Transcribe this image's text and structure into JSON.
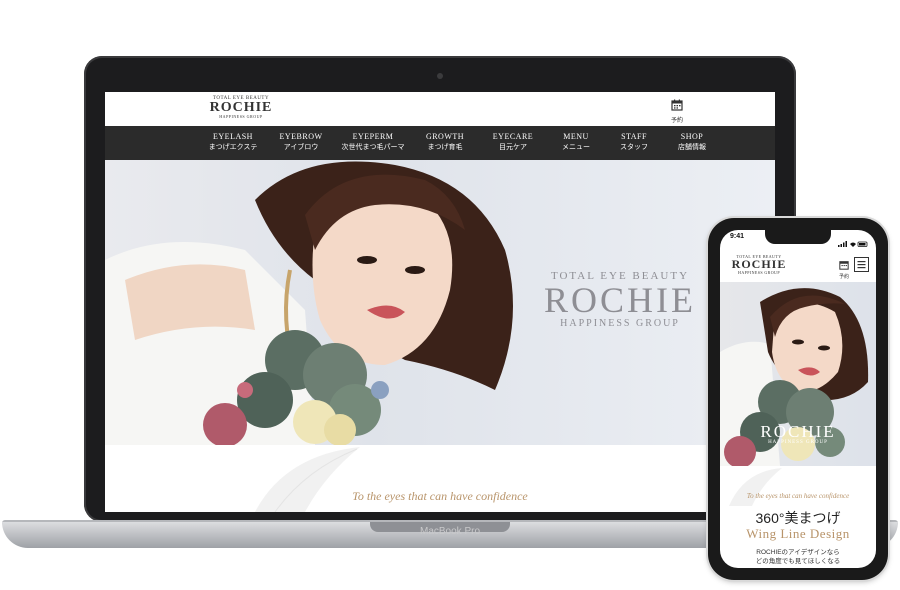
{
  "laptop": {
    "device_label": "MacBook Pro",
    "site": {
      "logo": {
        "tagline": "TOTAL EYE BEAUTY",
        "name": "ROCHIE",
        "sub": "HAPPINESS GROUP"
      },
      "reserve_label": "予約",
      "nav": [
        {
          "en": "EYELASH",
          "jp": "まつげエクステ"
        },
        {
          "en": "EYEBROW",
          "jp": "アイブロウ"
        },
        {
          "en": "EYEPERM",
          "jp": "次世代まつ毛パーマ"
        },
        {
          "en": "GROWTH",
          "jp": "まつげ育毛"
        },
        {
          "en": "EYECARE",
          "jp": "目元ケア"
        },
        {
          "en": "MENU",
          "jp": "メニュー"
        },
        {
          "en": "STAFF",
          "jp": "スタッフ"
        },
        {
          "en": "SHOP",
          "jp": "店舗情報"
        }
      ],
      "hero_logo": {
        "tagline": "TOTAL EYE BEAUTY",
        "name": "ROCHIE",
        "sub": "HAPPINESS GROUP"
      },
      "script_tagline": "To the eyes that can have confidence"
    }
  },
  "phone": {
    "status_time": "9:41",
    "site": {
      "logo": {
        "tagline": "TOTAL EYE BEAUTY",
        "name": "ROCHIE",
        "sub": "HAPPINESS GROUP"
      },
      "reserve_label": "予約",
      "hero_logo": {
        "name": "ROCHIE",
        "sub": "HAPPINESS GROUP"
      },
      "script_tagline": "To the eyes that can have confidence",
      "headline": "360°美まつげ",
      "subheadline": "Wing Line Design",
      "body_line1": "ROCHIEのアイデザインなら",
      "body_line2": "どの角度でも見てほしくなる"
    }
  },
  "colors": {
    "nav_bg": "#2b2b2b",
    "accent_gold": "#b8946a",
    "brand_text": "#333333"
  }
}
